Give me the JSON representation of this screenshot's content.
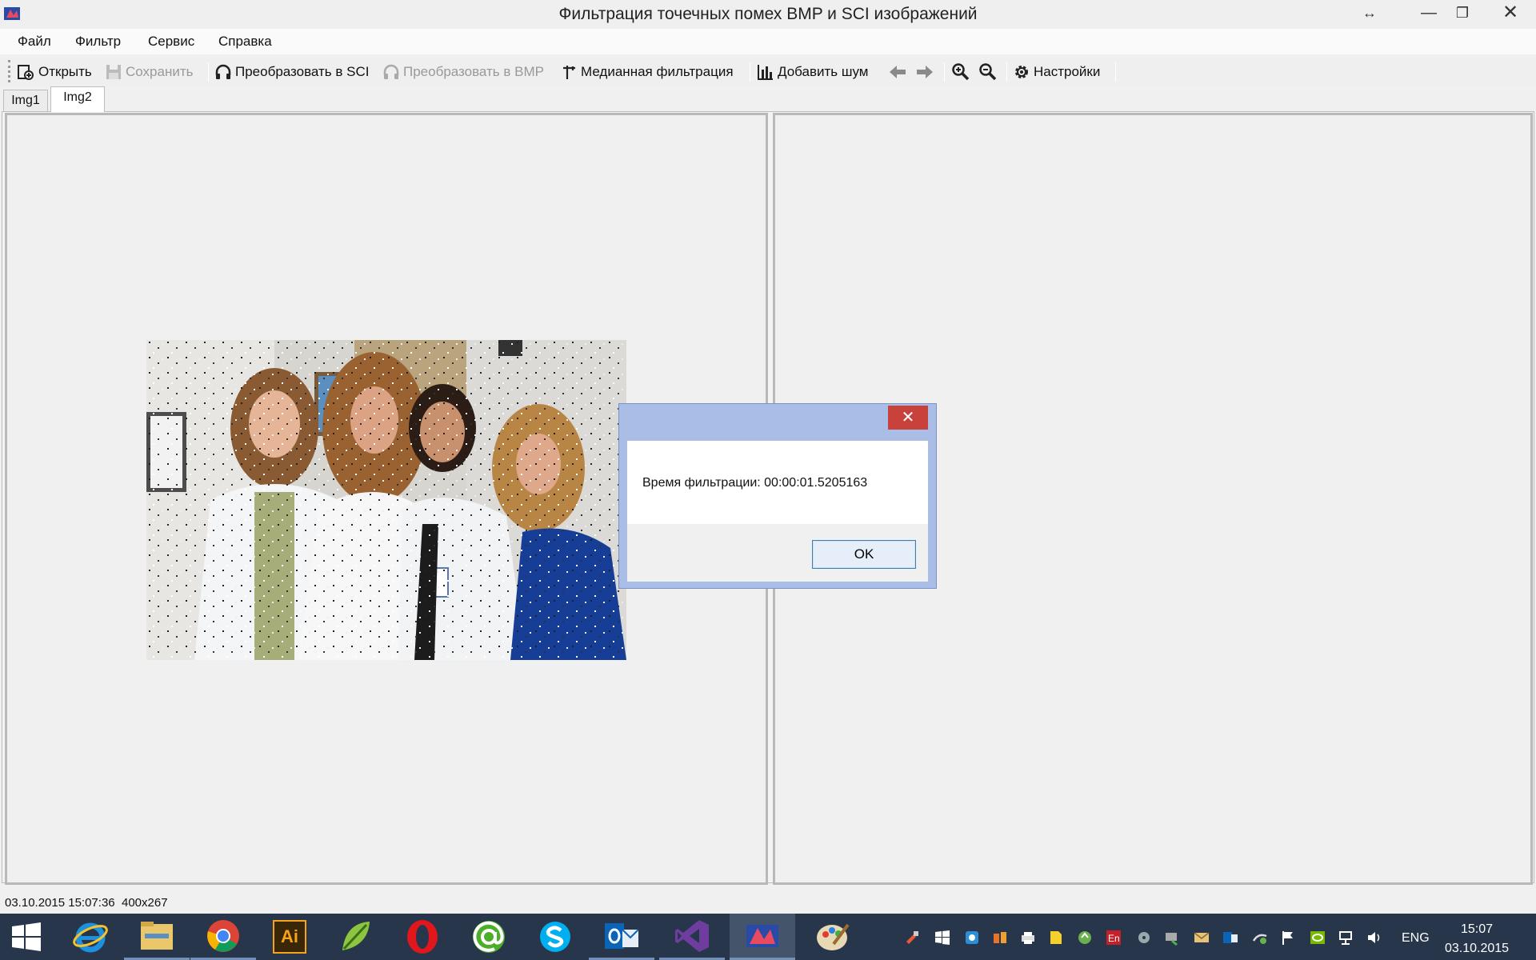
{
  "window": {
    "title": "Фильтрация точечных помех BMP и SCI изображений"
  },
  "menu": [
    "Файл",
    "Фильтр",
    "Сервис",
    "Справка"
  ],
  "toolbar": {
    "open": "Открыть",
    "save": "Сохранить",
    "to_sci": "Преобразовать в SCI",
    "to_bmp": "Преобразовать в BMP",
    "median": "Медианная фильтрация",
    "add_noise": "Добавить шум",
    "settings": "Настройки"
  },
  "tabs": [
    "Img1",
    "Img2"
  ],
  "active_tab": "Img2",
  "dialog": {
    "message": "Время фильтрации: 00:00:01.5205163",
    "ok": "OK"
  },
  "status": {
    "datetime": "03.10.2015 15:07:36",
    "size": "400x267"
  },
  "taskbar": {
    "apps": [
      "start-icon",
      "internet-explorer-icon",
      "file-explorer-icon",
      "chrome-icon",
      "illustrator-icon",
      "app-leaf-icon",
      "opera-icon",
      "mail-agent-icon",
      "skype-icon",
      "outlook-icon",
      "visual-studio-icon",
      "filter-app-icon",
      "paint-icon"
    ],
    "illustrator_label": "Ai",
    "language": "ENG",
    "time": "15:07",
    "date": "03.10.2015"
  },
  "colors": {
    "titlebar": "#efefef",
    "dialog_frame": "#a9bde6",
    "close_red": "#c9413b",
    "taskbar": "#27364b"
  }
}
